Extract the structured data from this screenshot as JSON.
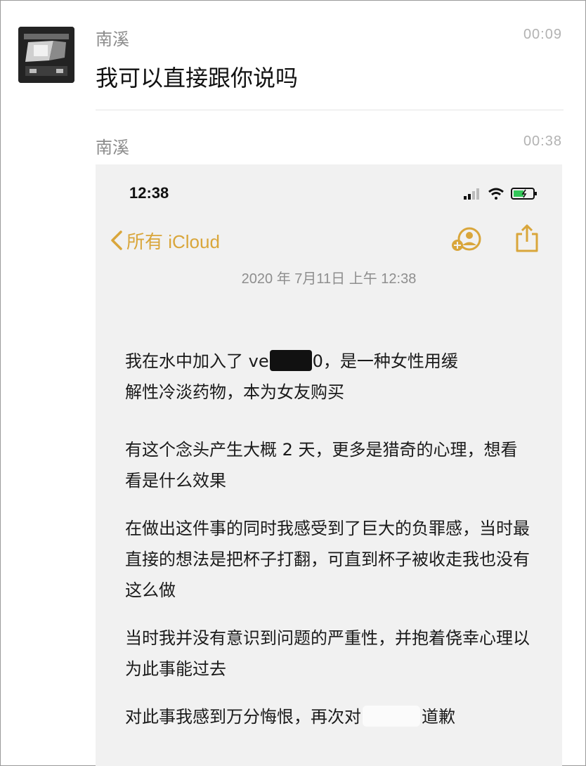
{
  "messages": [
    {
      "sender": "南溪",
      "time": "00:09",
      "text": "我可以直接跟你说吗"
    },
    {
      "sender": "南溪",
      "time": "00:38"
    }
  ],
  "screenshot": {
    "status_time": "12:38",
    "back_label": "所有 iCloud",
    "date": "2020 年 7月11日 上午 12:38",
    "accent_color": "#d9a63b",
    "icons": [
      "signal-icon",
      "wifi-icon",
      "battery-icon",
      "back-chevron-icon",
      "collaborate-icon",
      "share-icon"
    ],
    "paragraphs": {
      "p1_a": "我在水中加入了 ve",
      "p1_b": "0，是一种女性用缓",
      "p1_c": "解性冷淡药物，本为女友购买",
      "p2": "有这个念头产生大概 2 天，更多是猎奇的心理，想看看是什么效果",
      "p3": "在做出这件事的同时我感受到了巨大的负罪感，当时最直接的想法是把杯子打翻，可直到杯子被收走我也没有这么做",
      "p4": "当时我并没有意识到问题的严重性，并抱着侥幸心理以为此事能过去",
      "p5_a": "对此事我感到万分悔恨，再次对",
      "p5_b": "道歉"
    }
  }
}
